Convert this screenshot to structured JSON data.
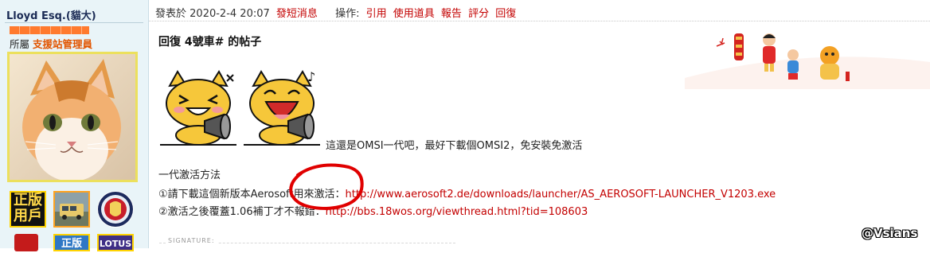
{
  "user": {
    "name": "Lloyd Esq.(貓大)",
    "group_prefix": "所屬",
    "group_name": "支援站管理員",
    "medals": [
      "正版用戶",
      "正版",
      "LOTUS"
    ]
  },
  "post": {
    "posted_label": "發表於",
    "datetime": "2020-2-4 20:07",
    "short_message": "發短消息",
    "actions_label": "操作:",
    "actions": [
      "引用",
      "使用道具",
      "報告",
      "評分",
      "回復"
    ],
    "title": "回復 4號車# 的帖子",
    "caption": "這還是OMSI一代吧，最好下載個OMSI2，免安裝免激活",
    "method_title": "一代激活方法",
    "step1_text": "①請下載這個新版本Aerosoft用來激活：",
    "step1_url": "http://www.aerosoft2.de/downloads/launcher/AS_AEROSOFT-LAUNCHER_V1203.exe",
    "step2_text": "②激活之後覆蓋1.06補丁才不報錯：",
    "step2_url": "http://bbs.18wos.org/viewthread.html?tid=108603",
    "signature_label": "SIGNATURE:"
  },
  "watermark": "@Vsians",
  "icons": [
    "message-icon",
    "avatar-cat",
    "emoji-laugh",
    "emoji-happy",
    "new-year-banner"
  ]
}
